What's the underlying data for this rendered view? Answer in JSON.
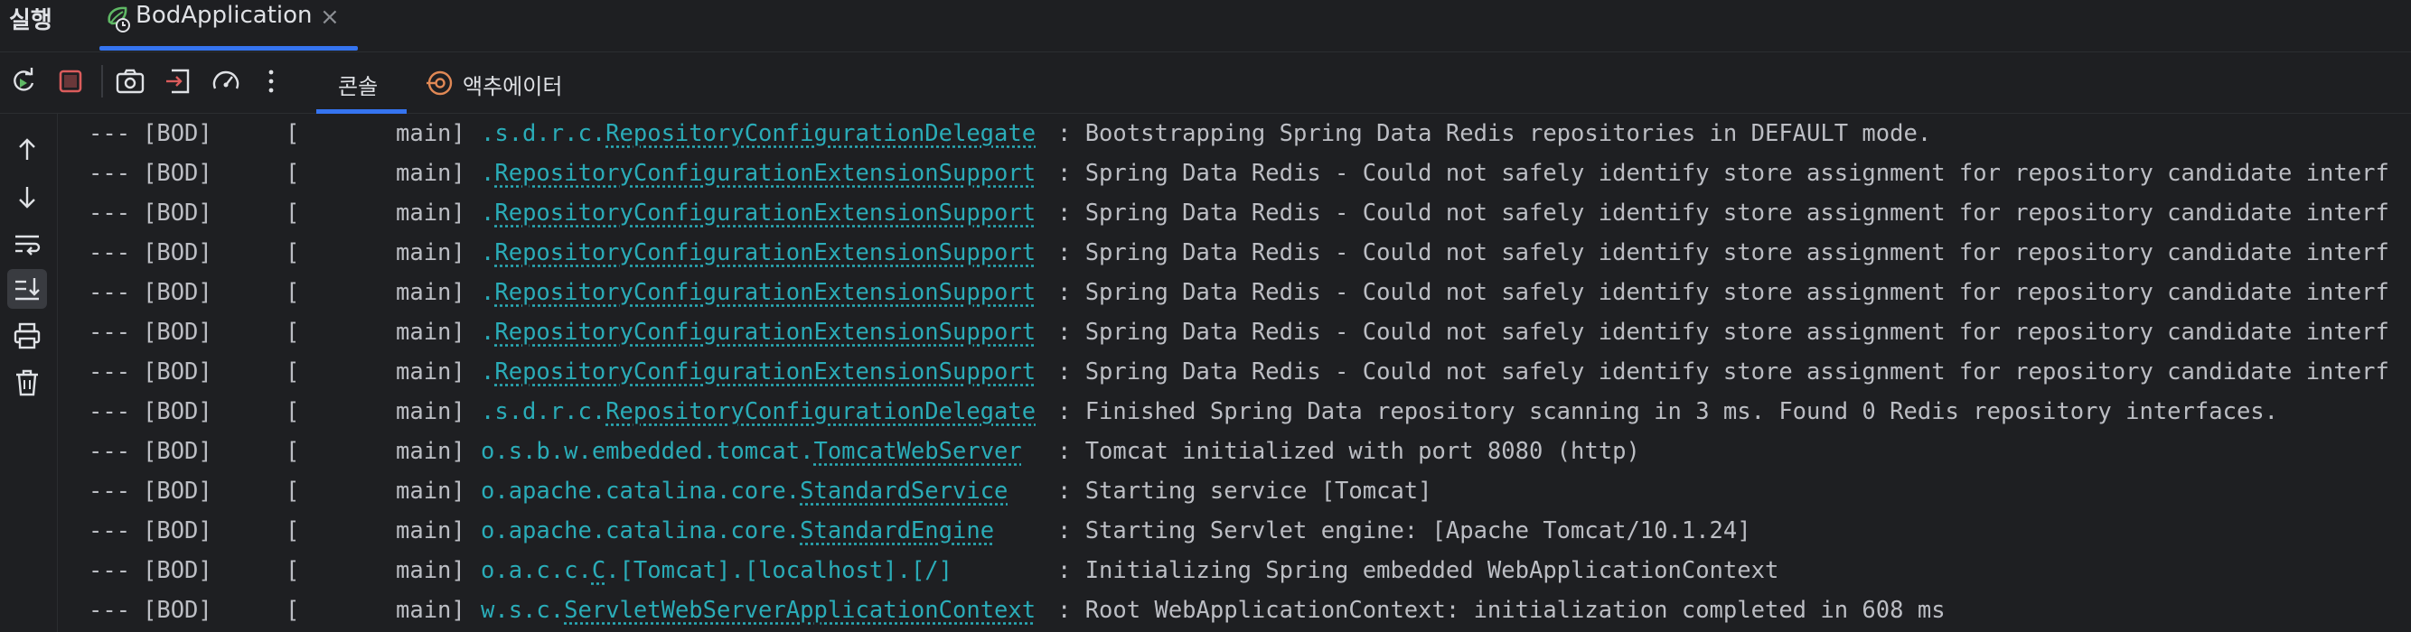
{
  "run_panel": {
    "title": "실행",
    "tab_label": "BodApplication",
    "tab_close": "×"
  },
  "toolbar": {
    "tabs": {
      "console": "콘솔",
      "actuator": "액추에이터"
    }
  },
  "colors": {
    "accent": "#3574f0",
    "logger": "#2aacb8",
    "text": "#bcbec4",
    "stop": "#db5c5c",
    "rerun": "#5fb865"
  },
  "icons": {
    "toolbar": [
      "rerun-icon",
      "stop-icon",
      "camera-icon",
      "exit-icon",
      "gauge-icon",
      "more-vertical-icon"
    ],
    "side": [
      "arrow-up-icon",
      "arrow-down-icon",
      "soft-wrap-icon",
      "scroll-to-end-icon",
      "print-icon",
      "trash-icon"
    ]
  },
  "log": [
    {
      "dash": "---",
      "app": "[BOD]",
      "bracket": "[",
      "thread": "main]",
      "logger_prefix": ".s.d.r.c.",
      "logger_class": "RepositoryConfigurationDelegate",
      "message": ": Bootstrapping Spring Data Redis repositories in DEFAULT mode."
    },
    {
      "dash": "---",
      "app": "[BOD]",
      "bracket": "[",
      "thread": "main]",
      "logger_prefix": ".",
      "logger_class": "RepositoryConfigurationExtensionSupport",
      "message": ": Spring Data Redis - Could not safely identify store assignment for repository candidate interf"
    },
    {
      "dash": "---",
      "app": "[BOD]",
      "bracket": "[",
      "thread": "main]",
      "logger_prefix": ".",
      "logger_class": "RepositoryConfigurationExtensionSupport",
      "message": ": Spring Data Redis - Could not safely identify store assignment for repository candidate interf"
    },
    {
      "dash": "---",
      "app": "[BOD]",
      "bracket": "[",
      "thread": "main]",
      "logger_prefix": ".",
      "logger_class": "RepositoryConfigurationExtensionSupport",
      "message": ": Spring Data Redis - Could not safely identify store assignment for repository candidate interf"
    },
    {
      "dash": "---",
      "app": "[BOD]",
      "bracket": "[",
      "thread": "main]",
      "logger_prefix": ".",
      "logger_class": "RepositoryConfigurationExtensionSupport",
      "message": ": Spring Data Redis - Could not safely identify store assignment for repository candidate interf"
    },
    {
      "dash": "---",
      "app": "[BOD]",
      "bracket": "[",
      "thread": "main]",
      "logger_prefix": ".",
      "logger_class": "RepositoryConfigurationExtensionSupport",
      "message": ": Spring Data Redis - Could not safely identify store assignment for repository candidate interf"
    },
    {
      "dash": "---",
      "app": "[BOD]",
      "bracket": "[",
      "thread": "main]",
      "logger_prefix": ".",
      "logger_class": "RepositoryConfigurationExtensionSupport",
      "message": ": Spring Data Redis - Could not safely identify store assignment for repository candidate interf"
    },
    {
      "dash": "---",
      "app": "[BOD]",
      "bracket": "[",
      "thread": "main]",
      "logger_prefix": ".s.d.r.c.",
      "logger_class": "RepositoryConfigurationDelegate",
      "message": ": Finished Spring Data repository scanning in 3 ms. Found 0 Redis repository interfaces."
    },
    {
      "dash": "---",
      "app": "[BOD]",
      "bracket": "[",
      "thread": "main]",
      "logger_prefix": "o.s.b.w.embedded.tomcat.",
      "logger_class": "TomcatWebServer",
      "message": ": Tomcat initialized with port 8080 (http)"
    },
    {
      "dash": "---",
      "app": "[BOD]",
      "bracket": "[",
      "thread": "main]",
      "logger_prefix": "o.apache.catalina.core.",
      "logger_class": "StandardService",
      "message": ": Starting service [Tomcat]"
    },
    {
      "dash": "---",
      "app": "[BOD]",
      "bracket": "[",
      "thread": "main]",
      "logger_prefix": "o.apache.catalina.core.",
      "logger_class": "StandardEngine",
      "message": ": Starting Servlet engine: [Apache Tomcat/10.1.24]"
    },
    {
      "dash": "---",
      "app": "[BOD]",
      "bracket": "[",
      "thread": "main]",
      "logger_prefix": "o.a.c.c.",
      "logger_class": "C",
      "logger_suffix": ".[Tomcat].[localhost].[/]",
      "message": ": Initializing Spring embedded WebApplicationContext"
    },
    {
      "dash": "---",
      "app": "[BOD]",
      "bracket": "[",
      "thread": "main]",
      "logger_prefix": "w.s.c.",
      "logger_class": "ServletWebServerApplicationContext",
      "message": ": Root WebApplicationContext: initialization completed in 608 ms"
    }
  ]
}
